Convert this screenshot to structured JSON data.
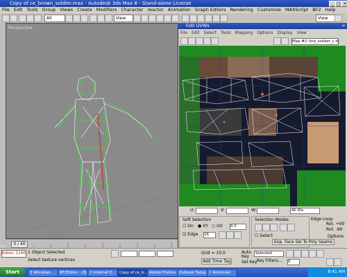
{
  "window": {
    "title": "Copy of ce_brown_soldier.max - Autodesk 3ds Max 8 - Stand-alone License"
  },
  "menu": {
    "items": [
      "File",
      "Edit",
      "Tools",
      "Group",
      "Views",
      "Create",
      "Modifiers",
      "Character",
      "reactor",
      "Animation",
      "Graph Editors",
      "Rendering",
      "Customize",
      "MAXScript",
      "BF2",
      "Help"
    ]
  },
  "toolbar": {
    "filter_value": "All",
    "view_value": "View",
    "view_value_right": "View"
  },
  "viewport": {
    "label": "Perspective"
  },
  "uv_editor": {
    "title": "Edit UVWs",
    "menu": [
      "File",
      "Edit",
      "Select",
      "Tools",
      "Mapping",
      "Options",
      "Display",
      "View"
    ],
    "map_dropdown": "Map #2 (ind_soldier_c.dds)",
    "u_label": "U:",
    "v_label": "V:",
    "w_label": "W:",
    "all_ids": "All IDs",
    "soft_selection": {
      "title": "Soft Selection",
      "on_label": "On",
      "xy_label": "XY",
      "uv_label": "UV",
      "falloff_value": "0.0",
      "edge_label": "Edge",
      "edge_value": "16"
    },
    "selection_modes": {
      "title": "Selection Modes",
      "select_label": "Select",
      "edge_loop_label": "Edge Loop"
    },
    "rot_plus": "Rot. +90",
    "rot_minus": "Rot. -90",
    "options_label": "Options",
    "exp_face_sel": "Exp. Face Sel To Poly Seams"
  },
  "timeline": {
    "frame": "0 / 40"
  },
  "status": {
    "objects": "1 Object Selected",
    "prompt": "Select texture vertices",
    "grid": "Grid = 10.0",
    "add_time_tag": "Add Time Tag",
    "autokey": "Auto Key",
    "setkey": "Set Key",
    "selected": "Selected",
    "key_filters": "Key Filters...",
    "frame_value": "0",
    "maxscript": "Editor: 1140"
  },
  "taskbar": {
    "start": "Start",
    "tasks": [
      "3 Windows ...",
      "BF2Editor - [B...",
      "2 Internet E...",
      "Copy of ce_b...",
      "Adobe Photos...",
      "Outlook Today...",
      "1 Reminder"
    ],
    "clock": "8:41 AM"
  }
}
